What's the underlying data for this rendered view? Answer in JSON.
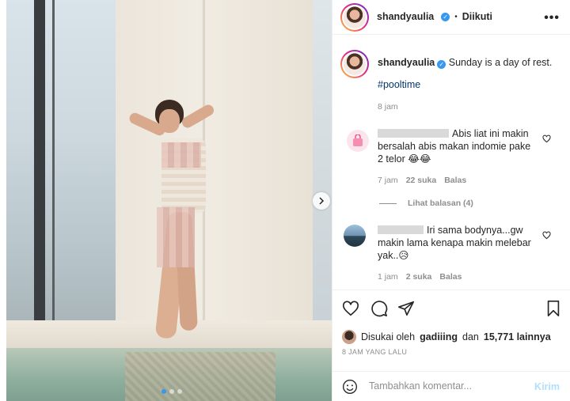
{
  "header": {
    "username": "shandyaulia",
    "follow_label": "Diikuti",
    "separator": "•"
  },
  "caption": {
    "username": "shandyaulia",
    "text": "Sunday is a day of rest.",
    "hashtag": "#pooltime",
    "time": "8 jam"
  },
  "comments": [
    {
      "text": "Abis liat ini makin bersalah abis makan indomie pake 2 telor 😂😂",
      "time": "7 jam",
      "likes": "22 suka",
      "reply_label": "Balas",
      "avatar_icon": "bag-avatar"
    },
    {
      "text": "Iri sama bodynya...gw makin lama kenapa makin melebar yak..😥",
      "time": "1 jam",
      "likes": "2 suka",
      "reply_label": "Balas",
      "avatar_icon": "lake-avatar"
    }
  ],
  "replies_label": "Lihat balasan (4)",
  "likes": {
    "prefix": "Disukai oleh",
    "user": "gadiiing",
    "joiner": "dan",
    "count": "15,771 lainnya"
  },
  "post_time": "8 JAM YANG LALU",
  "add_comment": {
    "placeholder": "Tambahkan komentar...",
    "post_label": "Kirim"
  },
  "carousel": {
    "current_index": 1,
    "total": 3
  },
  "colors": {
    "verified": "#3897f0",
    "hashtag": "#00376b",
    "muted": "#8e8e8e",
    "post_disabled": "#b2dffc"
  }
}
